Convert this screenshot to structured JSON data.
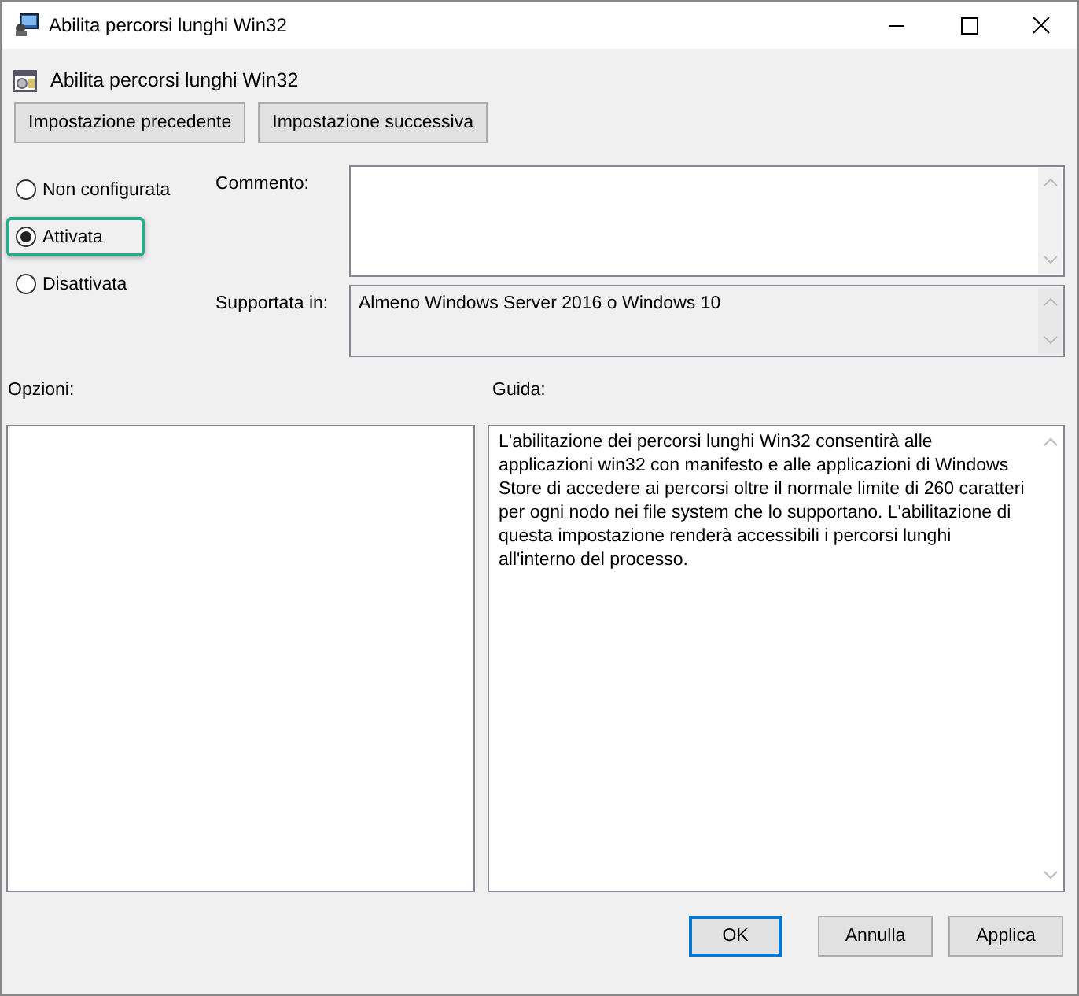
{
  "window": {
    "title": "Abilita percorsi lunghi Win32"
  },
  "header": {
    "title": "Abilita percorsi lunghi Win32"
  },
  "nav_buttons": [
    "Impostazione precedente",
    "Impostazione successiva"
  ],
  "options": [
    {
      "label": "Non configurata",
      "selected": false
    },
    {
      "label": "Attivata",
      "selected": true
    },
    {
      "label": "Disattivata",
      "selected": false
    }
  ],
  "comment": {
    "label": "Commento:"
  },
  "supported": {
    "label": "Supportata in:",
    "value": "Almeno Windows Server 2016 o Windows 10"
  },
  "options_panel": {
    "label": "Opzioni:"
  },
  "help_panel": {
    "label": "Guida:",
    "text": "L'abilitazione dei percorsi lunghi Win32 consentirà alle applicazioni win32 con manifesto e alle applicazioni di Windows Store di accedere ai percorsi oltre il normale limite di 260 caratteri per ogni nodo nei file system che lo supportano. L'abilitazione di questa impostazione renderà accessibili i percorsi lunghi all'interno del processo."
  },
  "buttons": [
    {
      "label": "OK",
      "default": true
    },
    {
      "label": "Annulla",
      "default": false
    },
    {
      "label": "Applica",
      "default": false
    }
  ]
}
